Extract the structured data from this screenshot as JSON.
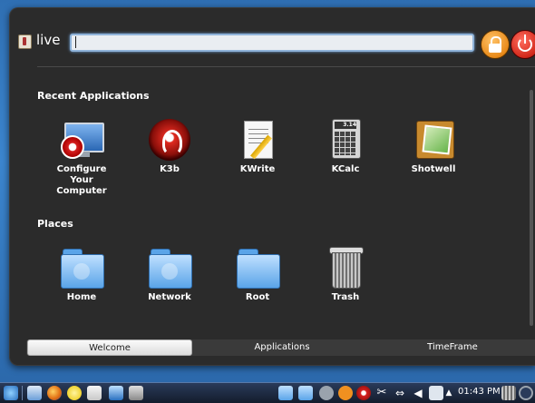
{
  "launcher": {
    "username": "live",
    "search": {
      "value": "",
      "placeholder": ""
    },
    "sections": {
      "recent_title": "Recent Applications",
      "places_title": "Places"
    },
    "recent_apps": [
      {
        "label": "Configure\nYour\nComputer",
        "icon": "configure-computer-icon"
      },
      {
        "label": "K3b",
        "icon": "k3b-icon"
      },
      {
        "label": "KWrite",
        "icon": "kwrite-icon"
      },
      {
        "label": "KCalc",
        "icon": "kcalc-icon"
      },
      {
        "label": "Shotwell",
        "icon": "shotwell-icon"
      }
    ],
    "kcalc_screen": "3.14",
    "places": [
      {
        "label": "Home",
        "icon": "home-folder-icon"
      },
      {
        "label": "Network",
        "icon": "network-folder-icon"
      },
      {
        "label": "Root",
        "icon": "root-folder-icon"
      },
      {
        "label": "Trash",
        "icon": "trash-icon"
      }
    ],
    "tabs": [
      {
        "label": "Welcome",
        "active": true
      },
      {
        "label": "Applications",
        "active": false
      },
      {
        "label": "TimeFrame",
        "active": false
      }
    ]
  },
  "taskbar": {
    "clock": "01:43 PM",
    "launchers": [
      "menu-icon",
      "files-icon",
      "firefox-icon",
      "chat-icon",
      "mail-icon",
      "media-player-icon",
      "software-icon"
    ],
    "tray": [
      "folder-icon",
      "folder-icon",
      "info-icon",
      "help-icon",
      "k3b-tray-icon",
      "scissors-icon",
      "usb-icon",
      "volume-icon",
      "network-icon",
      "up-arrow-icon",
      "trash-icon",
      "moon-icon"
    ]
  },
  "colors": {
    "desktop": "#3c86cf",
    "panel": "#2b2b2b",
    "taskbar": "#1c2a40",
    "accent": "#8fb3d9"
  }
}
